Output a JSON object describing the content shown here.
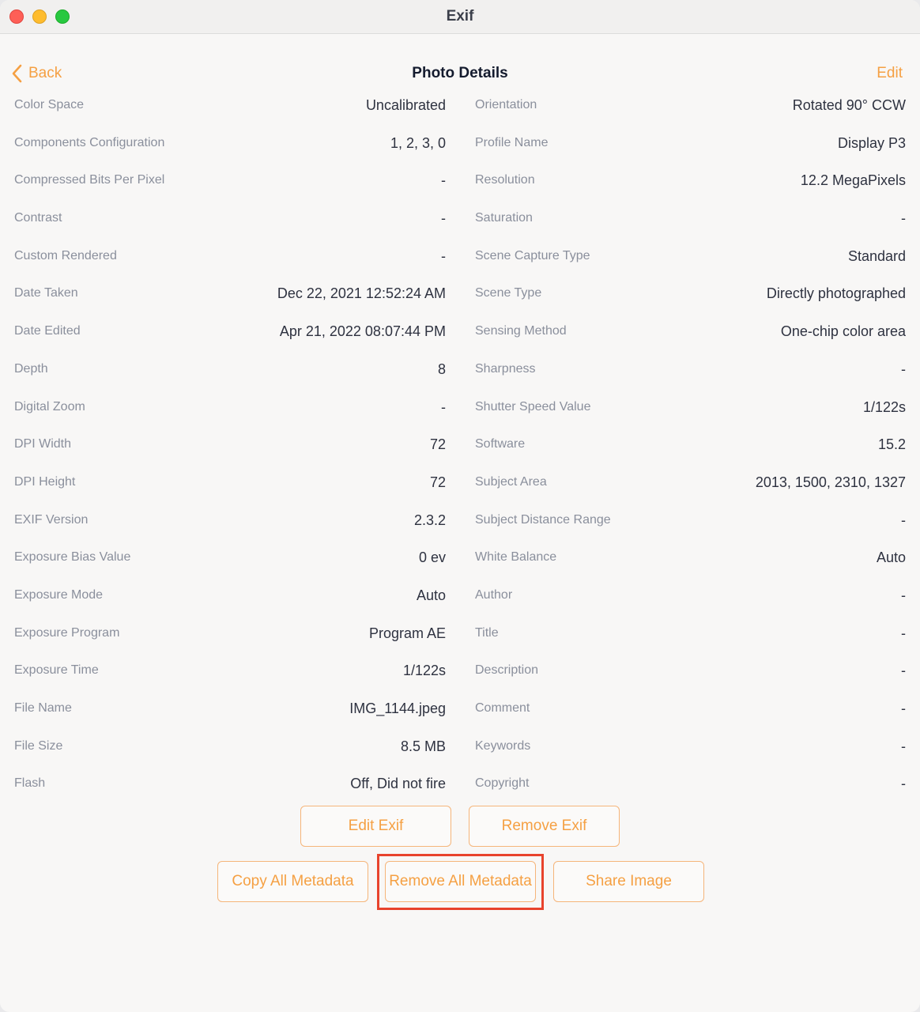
{
  "window": {
    "title": "Exif"
  },
  "nav": {
    "back_label": "Back",
    "title": "Photo Details",
    "edit_label": "Edit"
  },
  "left_rows": [
    {
      "label": "Color Space",
      "value": "Uncalibrated"
    },
    {
      "label": "Components Configuration",
      "value": "1, 2, 3, 0"
    },
    {
      "label": "Compressed Bits Per Pixel",
      "value": "-"
    },
    {
      "label": "Contrast",
      "value": "-"
    },
    {
      "label": "Custom Rendered",
      "value": "-"
    },
    {
      "label": "Date Taken",
      "value": "Dec 22, 2021 12:52:24 AM"
    },
    {
      "label": "Date Edited",
      "value": "Apr 21, 2022 08:07:44 PM"
    },
    {
      "label": "Depth",
      "value": "8"
    },
    {
      "label": "Digital Zoom",
      "value": "-"
    },
    {
      "label": "DPI Width",
      "value": "72"
    },
    {
      "label": "DPI Height",
      "value": "72"
    },
    {
      "label": "EXIF Version",
      "value": "2.3.2"
    },
    {
      "label": "Exposure Bias Value",
      "value": "0 ev"
    },
    {
      "label": "Exposure Mode",
      "value": "Auto"
    },
    {
      "label": "Exposure Program",
      "value": "Program AE"
    },
    {
      "label": "Exposure Time",
      "value": "1/122s"
    },
    {
      "label": "File Name",
      "value": "IMG_1144.jpeg"
    },
    {
      "label": "File Size",
      "value": "8.5 MB"
    },
    {
      "label": "Flash",
      "value": "Off, Did not fire"
    }
  ],
  "right_rows": [
    {
      "label": "Orientation",
      "value": "Rotated 90° CCW"
    },
    {
      "label": "Profile Name",
      "value": "Display P3"
    },
    {
      "label": "Resolution",
      "value": "12.2 MegaPixels"
    },
    {
      "label": "Saturation",
      "value": "-"
    },
    {
      "label": "Scene Capture Type",
      "value": "Standard"
    },
    {
      "label": "Scene Type",
      "value": "Directly photographed"
    },
    {
      "label": "Sensing Method",
      "value": "One-chip color area"
    },
    {
      "label": "Sharpness",
      "value": "-"
    },
    {
      "label": "Shutter Speed Value",
      "value": "1/122s"
    },
    {
      "label": "Software",
      "value": "15.2"
    },
    {
      "label": "Subject Area",
      "value": "2013, 1500, 2310, 1327"
    },
    {
      "label": "Subject Distance Range",
      "value": "-"
    },
    {
      "label": "White Balance",
      "value": "Auto"
    },
    {
      "label": "Author",
      "value": "-"
    },
    {
      "label": "Title",
      "value": "-"
    },
    {
      "label": "Description",
      "value": "-"
    },
    {
      "label": "Comment",
      "value": "-"
    },
    {
      "label": "Keywords",
      "value": "-"
    },
    {
      "label": "Copyright",
      "value": "-"
    }
  ],
  "buttons": {
    "edit_exif": "Edit Exif",
    "remove_exif": "Remove Exif",
    "copy_all": "Copy All Metadata",
    "remove_all": "Remove All Metadata",
    "share": "Share Image"
  },
  "colors": {
    "accent": "#f5a043",
    "highlight": "#e8432d"
  }
}
